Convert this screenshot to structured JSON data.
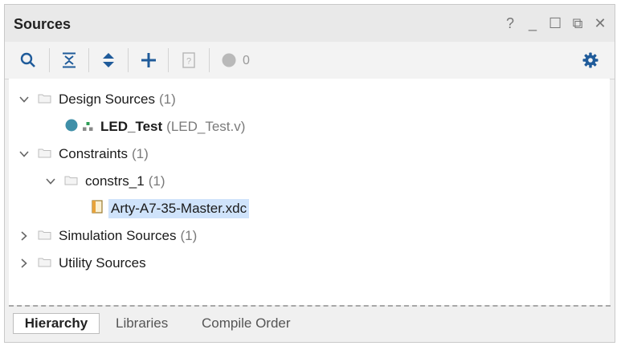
{
  "panel": {
    "title": "Sources",
    "window_controls": {
      "help": "?",
      "minimize": "_",
      "maximize": "☐",
      "float": "⧉",
      "close": "✕"
    }
  },
  "toolbar": {
    "icons": [
      "search-icon",
      "collapse-all-icon",
      "expand-all-icon",
      "add-icon",
      "hierarchy-update-icon",
      "status-dot-icon",
      "gear-icon"
    ],
    "count": "0"
  },
  "tree": {
    "design_sources": {
      "label": "Design Sources",
      "count": "(1)"
    },
    "led_test": {
      "label": "LED_Test",
      "file": "(LED_Test.v)"
    },
    "constraints": {
      "label": "Constraints",
      "count": "(1)"
    },
    "constrs_1": {
      "label": "constrs_1",
      "count": "(1)"
    },
    "xdc_file": {
      "label": "Arty-A7-35-Master.xdc"
    },
    "simulation_sources": {
      "label": "Simulation Sources",
      "count": "(1)"
    },
    "utility_sources": {
      "label": "Utility Sources"
    }
  },
  "tabs": [
    {
      "label": "Hierarchy",
      "active": true
    },
    {
      "label": "Libraries",
      "active": false
    },
    {
      "label": "Compile Order",
      "active": false
    }
  ],
  "colors": {
    "accent": "#1f5b9a",
    "selection": "#cfe3fb",
    "status_dot": "#3f8fa8"
  }
}
